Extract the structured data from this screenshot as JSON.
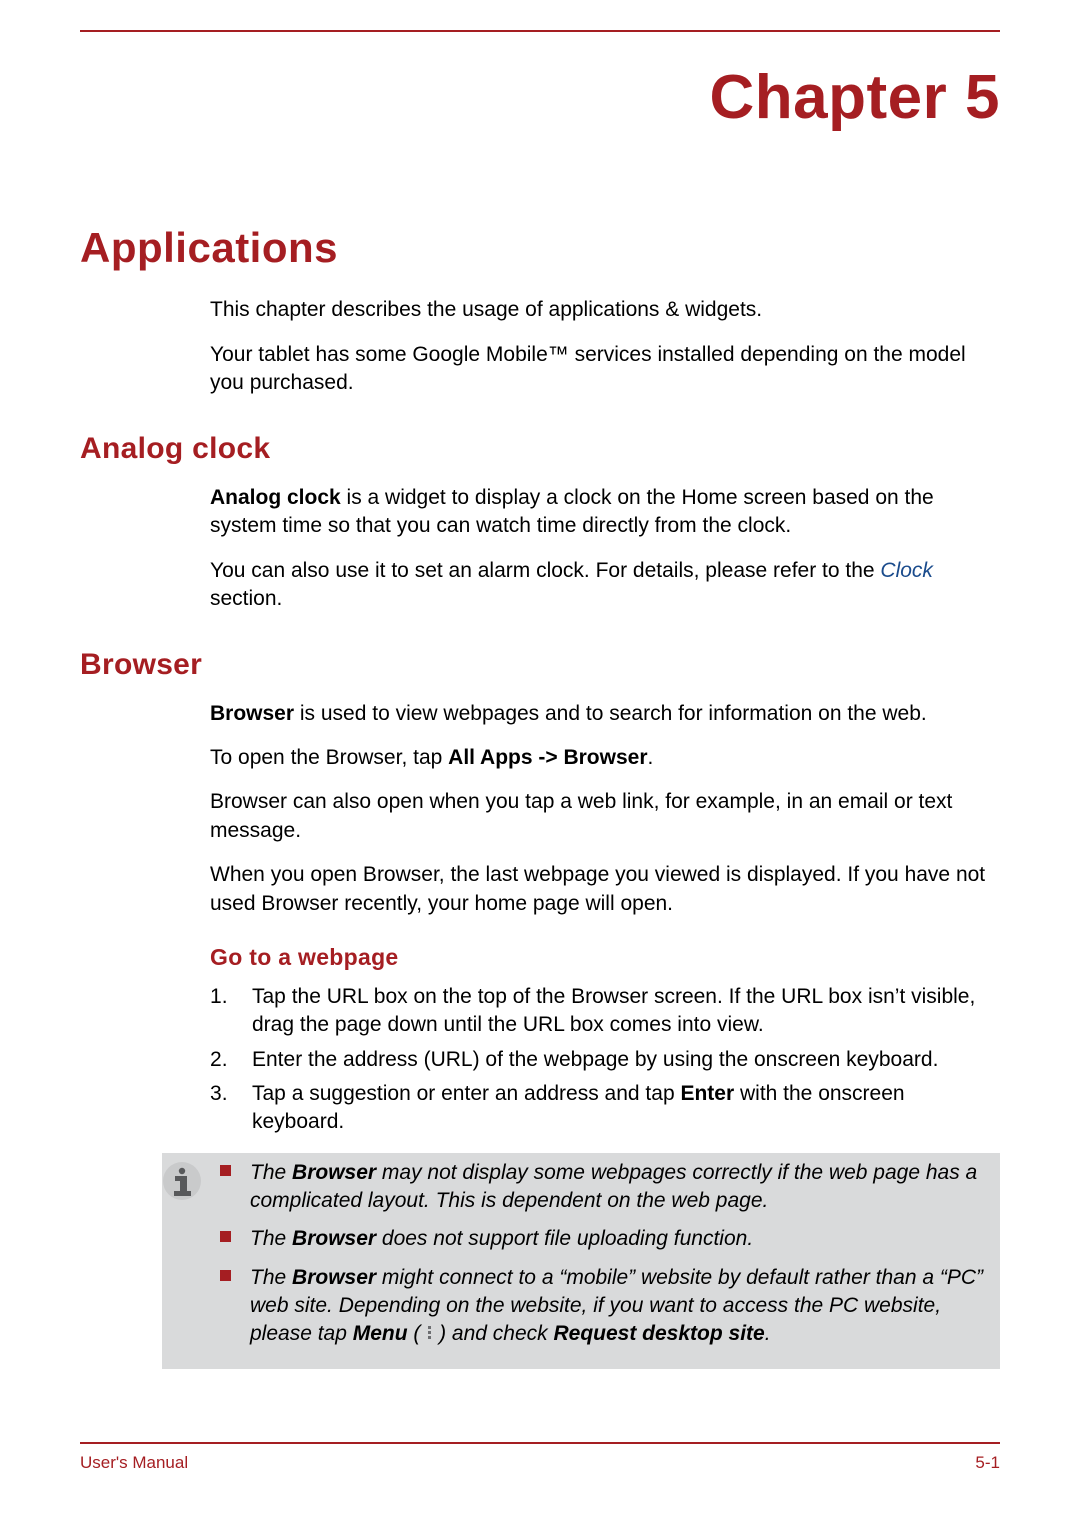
{
  "chapter": {
    "label": "Chapter 5"
  },
  "section": "Applications",
  "intro": {
    "p1": "This chapter describes the usage of applications & widgets.",
    "p2": "Your tablet has some Google Mobile™ services installed depending on the model you purchased."
  },
  "analog_clock": {
    "heading": "Analog clock",
    "p1_lead": "Analog clock",
    "p1_rest": " is a widget to display a clock on the Home screen based on the system time so that you can watch time directly from the clock.",
    "p2_pre": "You can also use it to set an alarm clock. For details, please refer to the ",
    "link": "Clock",
    "p2_post": " section."
  },
  "browser": {
    "heading": "Browser",
    "p1_lead": "Browser",
    "p1_rest": " is used to view webpages and to search for information on the web.",
    "p2_pre": "To open the Browser, tap ",
    "p2_bold": "All Apps -> Browser",
    "p2_post": ".",
    "p3": "Browser can also open when you tap a web link, for example, in an email or text message.",
    "p4": "When you open Browser, the last webpage you viewed is displayed. If you have not used Browser recently, your home page will open.",
    "goto": {
      "heading": "Go to a webpage",
      "steps": [
        "Tap the URL box on the top of the Browser screen. If the URL box isn’t visible, drag the page down until the URL box comes into view.",
        "Enter the address (URL) of the webpage by using the onscreen keyboard."
      ],
      "step3_pre": "Tap a suggestion or enter an address and tap ",
      "step3_bold": "Enter",
      "step3_post": " with the onscreen keyboard."
    },
    "notes": {
      "n1_pre": "The ",
      "n1_bold": "Browser",
      "n1_post": " may not display some webpages correctly if the web page has a complicated layout. This is dependent on the web page.",
      "n2_pre": "The ",
      "n2_bold": "Browser",
      "n2_post": " does not support file uploading function.",
      "n3_pre": "The ",
      "n3_bold1": "Browser",
      "n3_mid1": " might connect to a “mobile” website by default rather than a “PC” web site. Depending on the website, if you want to access the PC website, please tap ",
      "n3_bold2": "Menu",
      "n3_mid2": " ( ",
      "n3_mid3": " ) and check ",
      "n3_bold3": "Request desktop site",
      "n3_post": "."
    }
  },
  "footer": {
    "left": "User's Manual",
    "right": "5-1"
  }
}
